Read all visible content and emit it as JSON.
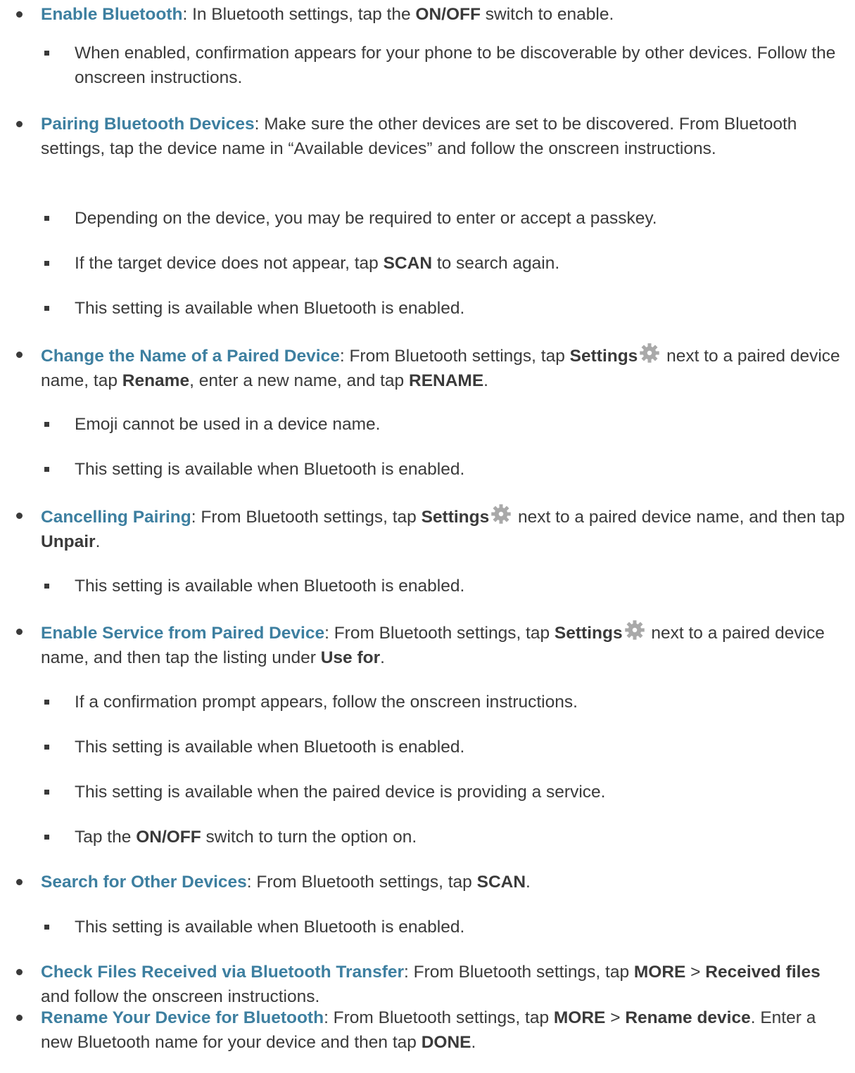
{
  "items": [
    {
      "h": "Enable Bluetooth",
      "p": [
        ": In Bluetooth settings, tap the ",
        {
          "k": "ON/OFF"
        },
        " switch to enable."
      ]
    },
    {
      "s": "When enabled, confirmation appears for your phone to be discoverable by other devices. Follow the onscreen instructions."
    },
    {
      "h": "Pairing Bluetooth Devices",
      "p": [
        ": Make sure the other devices are set to be discovered. From Bluetooth settings, tap the device name in “Available devices” and follow the onscreen instructions."
      ]
    },
    {
      "s": "Depending on the device, you may be required to enter or accept a passkey."
    },
    {
      "s": [
        "If the target device does not appear, tap ",
        {
          "k": "SCAN"
        },
        " to search again."
      ]
    },
    {
      "s": "This setting is available when Bluetooth is enabled."
    },
    {
      "h": "Change the Name of a Paired Device",
      "p": [
        ": From Bluetooth settings, tap ",
        {
          "k": "Settings"
        },
        {
          "icon": "gear-icon"
        },
        " next to a paired device name, tap ",
        {
          "k": "Rename"
        },
        ", enter a new name, and tap ",
        {
          "k": "RENAME"
        },
        "."
      ]
    },
    {
      "s": "Emoji cannot be used in a device name."
    },
    {
      "s": "This setting is available when Bluetooth is enabled."
    },
    {
      "h": "Cancelling Pairing",
      "p": [
        ": From Bluetooth settings, tap ",
        {
          "k": "Settings"
        },
        {
          "icon": "gear-icon"
        },
        " next to a paired device name, and then tap ",
        {
          "k": "Unpair"
        },
        "."
      ]
    },
    {
      "s": "This setting is available when Bluetooth is enabled."
    },
    {
      "h": "Enable Service from Paired Device",
      "p": [
        ": From Bluetooth settings, tap ",
        {
          "k": "Settings"
        },
        {
          "icon": "gear-icon"
        },
        " next to a paired device name, and then tap the listing under ",
        {
          "k": "Use for"
        },
        "."
      ]
    },
    {
      "s": "If a confirmation prompt appears, follow the onscreen instructions."
    },
    {
      "s": "This setting is available when Bluetooth is enabled."
    },
    {
      "s": "This setting is available when the paired device is providing a service."
    },
    {
      "s": [
        "Tap the ",
        {
          "k": "ON/OFF"
        },
        " switch to turn the option on."
      ]
    },
    {
      "h": "Search for Other Devices",
      "p": [
        ": From Bluetooth settings, tap ",
        {
          "k": "SCAN"
        },
        "."
      ]
    },
    {
      "s": "This setting is available when Bluetooth is enabled."
    },
    {
      "h": "Check Files Received via Bluetooth Transfer",
      "p": [
        ": From Bluetooth settings, tap ",
        {
          "k": "MORE"
        },
        " > ",
        {
          "k": "Received files"
        },
        " and follow the onscreen instructions."
      ]
    },
    {
      "h": "Rename Your Device for Bluetooth",
      "p": [
        ": From Bluetooth settings, tap ",
        {
          "k": "MORE"
        },
        " > ",
        {
          "k": "Rename device"
        },
        ". Enter a new Bluetooth name for your device and then tap ",
        {
          "k": "DONE"
        },
        "."
      ]
    }
  ],
  "colors": {
    "heading": "#3d7fa0",
    "text": "#3a3a3a",
    "icon": "#a9a9a9"
  }
}
